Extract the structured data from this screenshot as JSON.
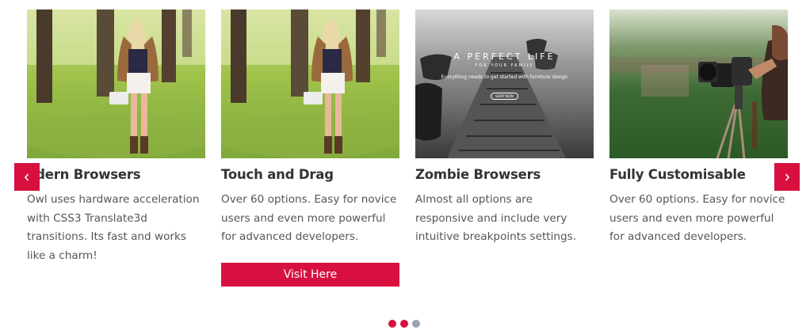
{
  "cards": [
    {
      "title": "odern Browsers",
      "text": "Owl uses hardware acceleration with CSS3 Translate3d transitions. Its fast and works like a charm!",
      "photo": "woman-in-park-photo"
    },
    {
      "title": "Touch and Drag",
      "text": "Over 60 options. Easy for novice users and even more powerful for advanced developers.",
      "photo": "woman-in-park-photo",
      "button": "Visit Here"
    },
    {
      "title": "Zombie Browsers",
      "text": "Almost all options are responsive and include very intuitive breakpoints settings.",
      "photo": "lake-pier-photo"
    },
    {
      "title": "Fully Customisable",
      "text": "Over 60 options. Easy for novice users and even more powerful for advanced developers.",
      "photo": "photographer-camera-photo"
    }
  ],
  "banner": {
    "headline": "A PERFECT LIFE",
    "sub": "FOR YOUR FAMILY",
    "tagline": "Everything needs to get started with furniture design",
    "cta": "SHOP NOW"
  },
  "nav": {
    "prev_icon": "chevron-left-icon",
    "next_icon": "chevron-right-icon"
  },
  "dots": [
    {
      "active": true
    },
    {
      "active": true
    },
    {
      "active": false
    }
  ],
  "colors": {
    "accent": "#d8103f",
    "dot_inactive": "#9aa3ab"
  }
}
